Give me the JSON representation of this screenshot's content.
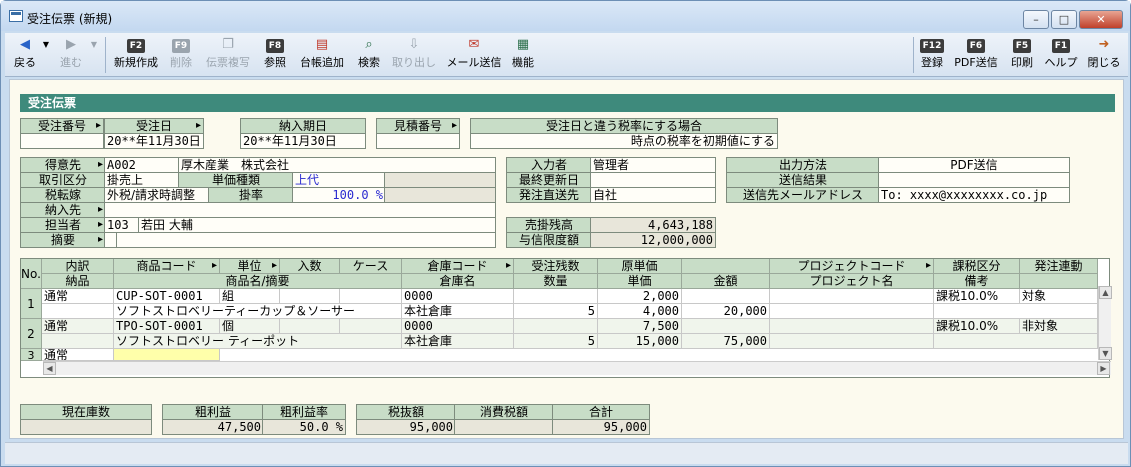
{
  "window": {
    "title": "受注伝票 (新規)",
    "minimize": "–",
    "maximize": "□",
    "close": "✕"
  },
  "toolbar": {
    "back": "戻る",
    "forward": "進む",
    "new_key": "F2",
    "new": "新規作成",
    "delete_key": "F9",
    "delete": "削除",
    "copy": "伝票複写",
    "ref_key": "F8",
    "ref": "参照",
    "ledger": "台帳追加",
    "search": "検索",
    "import": "取り出し",
    "mail": "メール送信",
    "func": "機能",
    "save_key": "F12",
    "save": "登録",
    "pdf_key": "F6",
    "pdf": "PDF送信",
    "print_key": "F5",
    "print": "印刷",
    "help_key": "F1",
    "help": "ヘルプ",
    "close": "閉じる"
  },
  "section_title": "受注伝票",
  "header": {
    "order_no_label": "受注番号",
    "order_no": "",
    "order_date_label": "受注日",
    "order_date": "20**年11月30日",
    "delivery_label": "納入期日",
    "delivery": "20**年11月30日",
    "estimate_label": "見積番号",
    "estimate": "",
    "tax_label": "受注日と違う税率にする場合",
    "tax_value": "時点の税率を初期値にする"
  },
  "customer": {
    "cust_label": "得意先",
    "cust_code": "A002",
    "cust_name": "厚木産業　株式会社",
    "trade_label": "取引区分",
    "trade": "掛売上",
    "unit_type_label": "単価種類",
    "unit_type": "上代",
    "tax_label": "税転嫁",
    "tax": "外税/請求時調整",
    "rate_label": "掛率",
    "rate": "100.0 %",
    "deliver_label": "納入先",
    "deliver": "",
    "staff_label": "担当者",
    "staff_code": "103",
    "staff_name": "若田 大輔",
    "memo_label": "摘要",
    "memo": ""
  },
  "input_info": {
    "inputter_label": "入力者",
    "inputter": "管理者",
    "updated_label": "最終更新日",
    "updated": "",
    "direct_label": "発注直送先",
    "direct": "自社",
    "balance_label": "売掛残高",
    "balance": "4,643,188",
    "limit_label": "与信限度額",
    "limit": "12,000,000"
  },
  "output": {
    "method_label": "出力方法",
    "method": "PDF送信",
    "result_label": "送信結果",
    "result": "",
    "email_label": "送信先メールアドレス",
    "email": "To: xxxx@xxxxxxxx.co.jp"
  },
  "grid": {
    "headers1": [
      "No.",
      "内訳",
      "商品コード",
      "単位",
      "入数",
      "ケース",
      "倉庫コード",
      "受注残数",
      "原単価",
      "",
      "プロジェクトコード",
      "課税区分",
      "発注連動"
    ],
    "headers2": [
      "納品",
      "商品名/摘要",
      "倉庫名",
      "数量",
      "単価",
      "金額",
      "プロジェクト名",
      "備考"
    ],
    "rows": [
      {
        "no": "1",
        "kind": "通常",
        "code": "CUP-SOT-0001",
        "unit": "組",
        "wh": "0000",
        "cost": "2,000",
        "tax": "課税10.0%",
        "order": "対象",
        "name": "ソフトストロベリーティーカップ＆ソーサー",
        "whname": "本社倉庫",
        "qty": "5",
        "price": "4,000",
        "amount": "20,000"
      },
      {
        "no": "2",
        "kind": "通常",
        "code": "TPO-SOT-0001",
        "unit": "個",
        "wh": "0000",
        "cost": "7,500",
        "tax": "課税10.0%",
        "order": "非対象",
        "name": "ソフトストロベリー ティーポット",
        "whname": "本社倉庫",
        "qty": "5",
        "price": "15,000",
        "amount": "75,000"
      },
      {
        "no": "3",
        "kind": "通常"
      }
    ]
  },
  "totals": {
    "stock_label": "現在庫数",
    "stock": "",
    "gross_label": "粗利益",
    "gross": "47,500",
    "gross_rate_label": "粗利益率",
    "gross_rate": "50.0 %",
    "net_label": "税抜額",
    "net": "95,000",
    "tax_label": "消費税額",
    "tax": "",
    "total_label": "合計",
    "total": "95,000"
  }
}
